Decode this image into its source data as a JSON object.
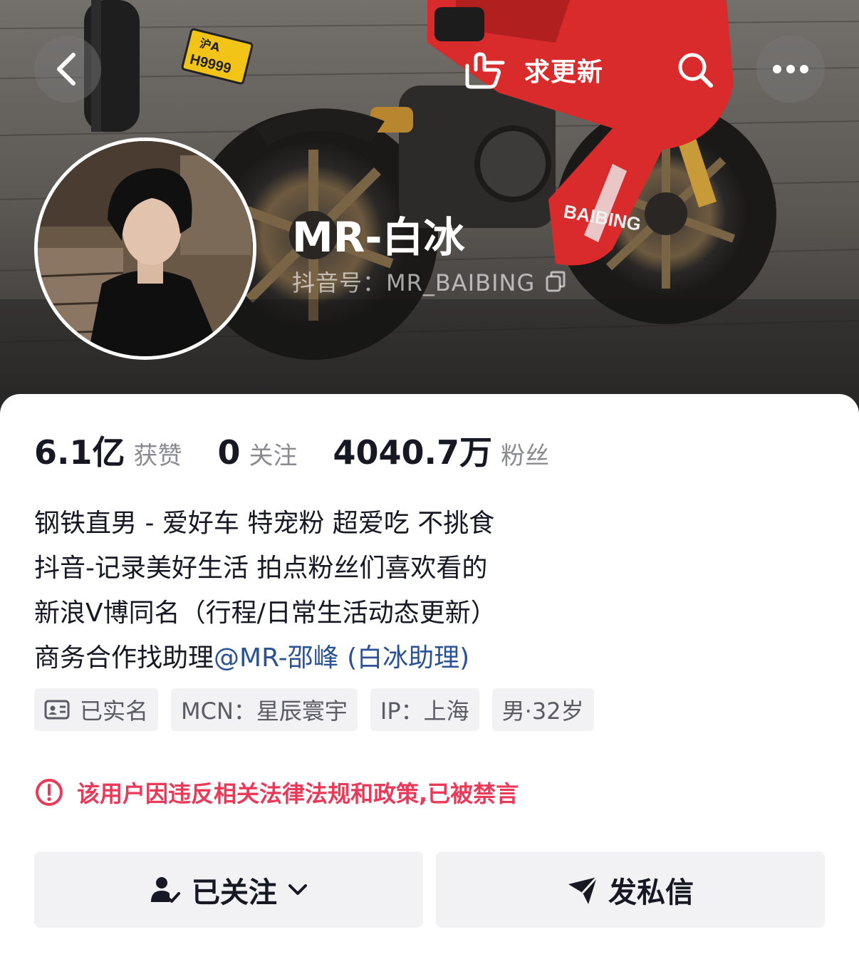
{
  "header": {
    "back_icon": "chevron-left-icon",
    "update_label": "求更新",
    "update_icon": "pointing-hand-icon",
    "search_icon": "search-icon",
    "more_icon": "more-dots-icon"
  },
  "cover": {
    "plate_text_top": "沪A",
    "plate_text_bottom": "H9999",
    "bike_text": "BAIBING"
  },
  "profile": {
    "nickname": "MR-白冰",
    "douyin_id": "抖音号：MR_BAIBING"
  },
  "stats": [
    {
      "value": "6.1亿",
      "label": "获赞"
    },
    {
      "value": "0",
      "label": "关注"
    },
    {
      "value": "4040.7万",
      "label": "粉丝"
    }
  ],
  "bio": {
    "line1": "钢铁直男 - 爱好车 特宠粉 超爱吃 不挑食",
    "line2": "抖音-记录美好生活 拍点粉丝们喜欢看的",
    "line3": "新浪Ⅴ博同名（行程/日常生活动态更新）",
    "line4_prefix": "商务合作找助理",
    "line4_mention": "@MR-邵峰 (白冰助理)"
  },
  "tags": {
    "verified": "已实名",
    "mcn": "MCN：星辰寰宇",
    "ip": "IP：上海",
    "gender_age": "男·32岁"
  },
  "notice": {
    "text": "该用户因违反相关法律法规和政策,已被禁言",
    "color": "#ea3a59"
  },
  "actions": {
    "follow_label": "已关注",
    "message_label": "发私信"
  },
  "colors": {
    "mention": "#2a5294",
    "bike_red": "#d92b2b"
  }
}
